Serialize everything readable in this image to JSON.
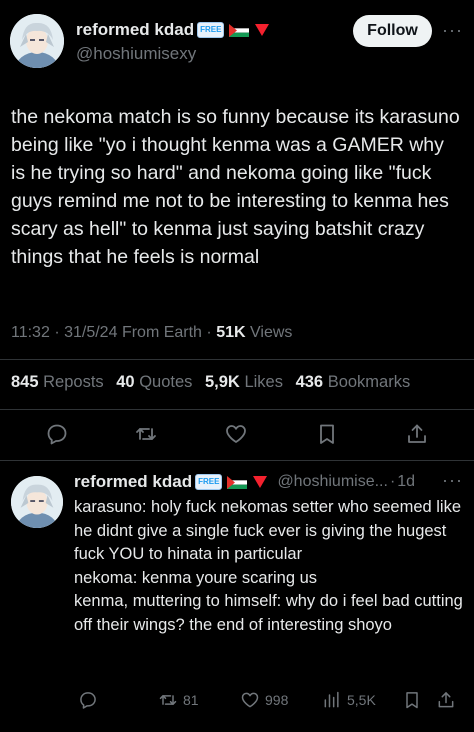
{
  "tweet": {
    "author_name": "reformed kdad",
    "badge_label": "FREE",
    "author_handle": "@hoshiumisexy",
    "follow_label": "Follow",
    "more_label": "···",
    "text": "the nekoma match is so funny because its karasuno being like \"yo i thought kenma was a GAMER why is he trying so hard\" and nekoma going like \"fuck guys remind me not to be interesting to kenma hes scary as hell\" to kenma just saying batshit crazy things that he feels is normal",
    "time": "11:32",
    "date": "31/5/24",
    "source": "From Earth",
    "separator": "·",
    "views_count": "51K",
    "views_label": "Views"
  },
  "stats": [
    {
      "count": "845",
      "label": "Reposts"
    },
    {
      "count": "40",
      "label": "Quotes"
    },
    {
      "count": "5,9K",
      "label": "Likes"
    },
    {
      "count": "436",
      "label": "Bookmarks"
    }
  ],
  "actions": [
    "reply-icon",
    "repost-icon",
    "like-icon",
    "bookmark-icon",
    "share-icon"
  ],
  "reply": {
    "author_name": "reformed kdad",
    "badge_label": "FREE",
    "author_handle": "@hoshiumise...",
    "separator": "·",
    "age": "1d",
    "more_label": "···",
    "text": "karasuno: holy fuck nekomas setter who seemed like he didnt give a single fuck ever is giving the hugest fuck YOU to hinata in particular\nnekoma: kenma youre scaring us\nkenma, muttering to himself: why do i feel bad cutting off their wings? the end of interesting shoyo",
    "reposts": "81",
    "likes": "998",
    "views": "5,5K"
  },
  "colors": {
    "background": "#000000",
    "text": "#e7e9ea",
    "muted": "#71767b",
    "divider": "#2f3336",
    "follow_bg": "#eff3f4",
    "flag_red": "#f4212e"
  }
}
